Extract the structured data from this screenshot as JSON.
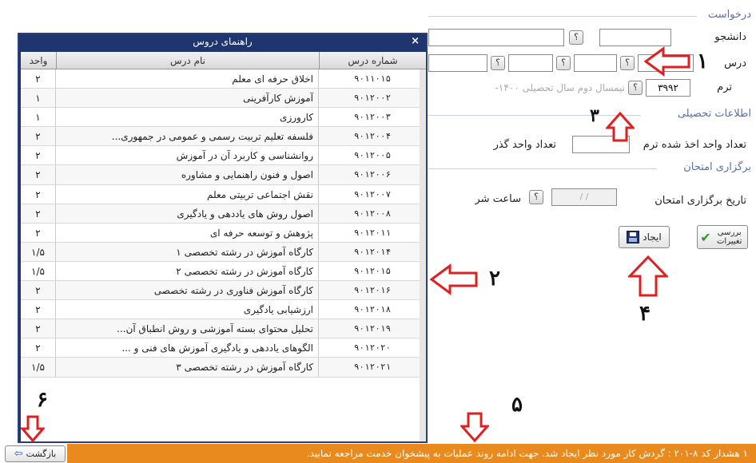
{
  "form": {
    "sections": {
      "request": "درخواست",
      "academic": "اطلاعات تحصیلی",
      "exam": "برگزاری امتحان"
    },
    "labels": {
      "student": "دانشجو",
      "course": "درس",
      "term": "ترم",
      "units_taken": "تعداد واحد اخذ شده ترم",
      "units_passed": "تعداد واحد گذر",
      "exam_date": "تاریخ برگزاری امتحان",
      "exam_time": "ساعت شر"
    },
    "term_value": "۳۹۹۲",
    "term_desc": "نیمسال دوم سال تحصیلی ۱۴۰۰-",
    "date_placeholder": "/   /",
    "q": "؟"
  },
  "buttons": {
    "create": "ایجاد",
    "review": "بررسی تغییرات",
    "back": "بازگشت"
  },
  "status": {
    "text": "۱  هشدار          کد ۸-۲۰۱ : گردش کار مورد نظر ایجاد شد. جهت ادامه روند عملیات به پیشخوان خدمت مراجعه نمایید."
  },
  "annotations": [
    "۱",
    "۲",
    "۳",
    "۴",
    "۵",
    "۶"
  ],
  "modal": {
    "title": "راهنمای دروس",
    "close": "×",
    "columns": {
      "code": "شماره درس",
      "name": "نام درس",
      "unit": "واحد"
    },
    "rows": [
      {
        "code": "۹۰۱۱۰۱۵",
        "name": "اخلاق حرفه ای معلم",
        "unit": "۲"
      },
      {
        "code": "۹۰۱۲۰۰۲",
        "name": "آموزش کارآفرینی",
        "unit": "۱"
      },
      {
        "code": "۹۰۱۲۰۰۳",
        "name": "کارورزی",
        "unit": "۱"
      },
      {
        "code": "۹۰۱۲۰۰۴",
        "name": "فلسفه تعلیم تربیت رسمی و عمومی در جمهوری...",
        "unit": "۲"
      },
      {
        "code": "۹۰۱۲۰۰۵",
        "name": "روانشناسی و کاربرد آن در آموزش",
        "unit": "۲"
      },
      {
        "code": "۹۰۱۲۰۰۶",
        "name": "اصول و فنون راهنمایی و مشاوره",
        "unit": "۲"
      },
      {
        "code": "۹۰۱۲۰۰۷",
        "name": "نقش اجتماعی تربیتی معلم",
        "unit": "۲"
      },
      {
        "code": "۹۰۱۲۰۰۸",
        "name": "اصول روش های یاددهی و یادگیری",
        "unit": "۲"
      },
      {
        "code": "۹۰۱۲۰۱۱",
        "name": "پژوهش و توسعه حرفه ای",
        "unit": "۲"
      },
      {
        "code": "۹۰۱۲۰۱۴",
        "name": "کارگاه آموزش در رشته تخصصی ۱",
        "unit": "۱/۵"
      },
      {
        "code": "۹۰۱۲۰۱۵",
        "name": "کارگاه آموزش در رشته تخصصی ۲",
        "unit": "۱/۵"
      },
      {
        "code": "۹۰۱۲۰۱۶",
        "name": "کارگاه آموزش فناوری در رشته تخصصی",
        "unit": "۲"
      },
      {
        "code": "۹۰۱۲۰۱۸",
        "name": "ارزشیابی یادگیری",
        "unit": "۲"
      },
      {
        "code": "۹۰۱۲۰۱۹",
        "name": "تحلیل محتوای بسته آموزشی و روش انطباق آن...",
        "unit": "۲"
      },
      {
        "code": "۹۰۱۲۰۲۰",
        "name": "الگوهای یاددهی و یادگیری آموزش های فنی و ...",
        "unit": "۲"
      },
      {
        "code": "۹۰۱۲۰۲۱",
        "name": "کارگاه آموزش در رشته تخصصی ۳",
        "unit": "۱/۵"
      }
    ]
  },
  "colors": {
    "accent": "#1f3570",
    "warn": "#e88a1e",
    "arrow": "#e02020"
  }
}
